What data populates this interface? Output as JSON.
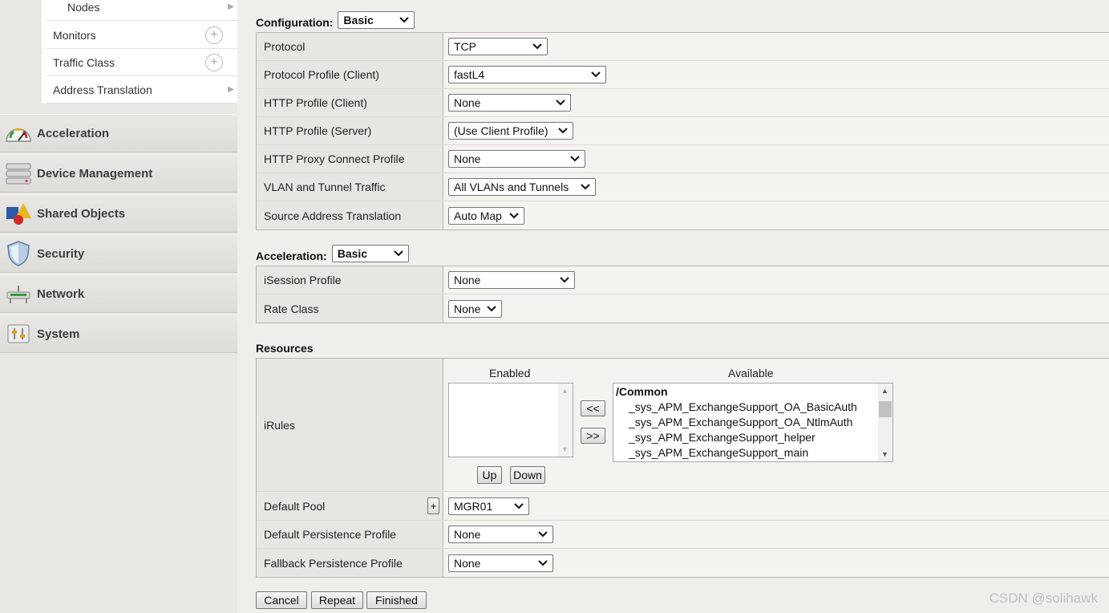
{
  "sidebar": {
    "submenu": [
      {
        "label": "Nodes",
        "trail": "arrow"
      },
      {
        "label": "Monitors",
        "trail": "plus"
      },
      {
        "label": "Traffic Class",
        "trail": "plus"
      },
      {
        "label": "Address Translation",
        "trail": "arrow"
      }
    ],
    "nav": [
      {
        "label": "Acceleration",
        "icon": "speedometer-icon"
      },
      {
        "label": "Device Management",
        "icon": "server-icon"
      },
      {
        "label": "Shared Objects",
        "icon": "shapes-icon"
      },
      {
        "label": "Security",
        "icon": "shield-icon"
      },
      {
        "label": "Network",
        "icon": "network-icon"
      },
      {
        "label": "System",
        "icon": "sliders-icon"
      }
    ]
  },
  "configuration": {
    "title": "Configuration:",
    "mode": "Basic",
    "rows": [
      {
        "label": "Protocol",
        "value": "TCP"
      },
      {
        "label": "Protocol Profile (Client)",
        "value": "fastL4"
      },
      {
        "label": "HTTP Profile (Client)",
        "value": "None"
      },
      {
        "label": "HTTP Profile (Server)",
        "value": "(Use Client Profile)"
      },
      {
        "label": "HTTP Proxy Connect Profile",
        "value": "None"
      },
      {
        "label": "VLAN and Tunnel Traffic",
        "value": "All VLANs and Tunnels"
      },
      {
        "label": "Source Address Translation",
        "value": "Auto Map"
      }
    ]
  },
  "acceleration": {
    "title": "Acceleration:",
    "mode": "Basic",
    "rows": [
      {
        "label": "iSession Profile",
        "value": "None"
      },
      {
        "label": "Rate Class",
        "value": "None"
      }
    ]
  },
  "resources": {
    "title": "Resources",
    "irules": {
      "label": "iRules",
      "enabled_header": "Enabled",
      "available_header": "Available",
      "move_left": "<<",
      "move_right": ">>",
      "up": "Up",
      "down": "Down",
      "available_group": "/Common",
      "available_items": [
        "_sys_APM_ExchangeSupport_OA_BasicAuth",
        "_sys_APM_ExchangeSupport_OA_NtlmAuth",
        "_sys_APM_ExchangeSupport_helper",
        "_sys_APM_ExchangeSupport_main"
      ]
    },
    "default_pool": {
      "label": "Default Pool",
      "add": "+",
      "value": "MGR01"
    },
    "default_persistence": {
      "label": "Default Persistence Profile",
      "value": "None"
    },
    "fallback_persistence": {
      "label": "Fallback Persistence Profile",
      "value": "None"
    }
  },
  "actions": {
    "cancel": "Cancel",
    "repeat": "Repeat",
    "finished": "Finished"
  },
  "watermark": "CSDN @solihawk"
}
